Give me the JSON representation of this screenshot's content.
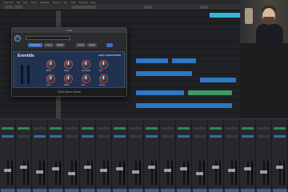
{
  "menubar": {
    "items": [
      "Logic Pro",
      "File",
      "Edit",
      "Track",
      "Navigate",
      "Record",
      "Mix",
      "View",
      "Window",
      "Help"
    ]
  },
  "plugin": {
    "window_title": "1 Kick",
    "brand": "Eventide",
    "model": "H910 HARMONIZER",
    "footer": "2016 Stereo Room",
    "header_buttons": [
      "Compare",
      "Copy",
      "Paste",
      "Undo",
      "Redo"
    ],
    "knob_labels": [
      "Pitch",
      "Delay",
      "Feedback",
      "Mix",
      "Tone",
      "Width",
      "Size",
      "Decay"
    ]
  },
  "colors": {
    "accent_blue": "#2f77c6",
    "region_green": "#3f9a63",
    "cyan": "#33b7d8"
  }
}
